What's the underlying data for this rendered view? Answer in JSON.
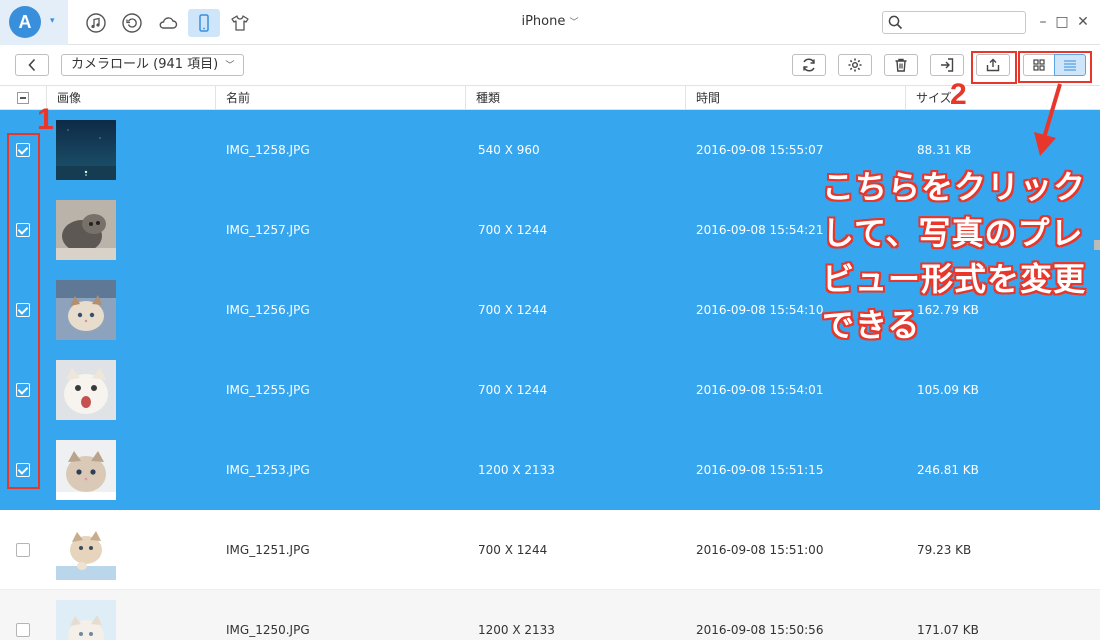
{
  "window": {
    "title": "iPhone",
    "search_placeholder": ""
  },
  "top_icons": [
    "music-icon",
    "restore-icon",
    "cloud-icon",
    "phone-icon",
    "tshirt-icon"
  ],
  "toolbar": {
    "album_label": "カメラロール (941 項目)"
  },
  "table": {
    "columns": [
      "画像",
      "名前",
      "種類",
      "時間",
      "サイズ"
    ],
    "rows": [
      {
        "name": "IMG_1258.JPG",
        "type": "540 X 960",
        "time": "2016-09-08 15:55:07",
        "size": "88.31 KB",
        "selected": true,
        "thumb": "night-sky"
      },
      {
        "name": "IMG_1257.JPG",
        "type": "700 X 1244",
        "time": "2016-09-08 15:54:21",
        "size": "",
        "selected": true,
        "thumb": "cat-gray"
      },
      {
        "name": "IMG_1256.JPG",
        "type": "700 X 1244",
        "time": "2016-09-08 15:54:10",
        "size": "162.79 KB",
        "selected": true,
        "thumb": "kitten-blanket"
      },
      {
        "name": "IMG_1255.JPG",
        "type": "700 X 1244",
        "time": "2016-09-08 15:54:01",
        "size": "105.09 KB",
        "selected": true,
        "thumb": "kitten-white"
      },
      {
        "name": "IMG_1253.JPG",
        "type": "1200 X 2133",
        "time": "2016-09-08 15:51:15",
        "size": "246.81 KB",
        "selected": true,
        "thumb": "kitten-tabby"
      },
      {
        "name": "IMG_1251.JPG",
        "type": "700 X 1244",
        "time": "2016-09-08 15:51:00",
        "size": "79.23 KB",
        "selected": false,
        "thumb": "kitten-paw"
      },
      {
        "name": "IMG_1250.JPG",
        "type": "1200 X 2133",
        "time": "2016-09-08 15:50:56",
        "size": "171.07 KB",
        "selected": false,
        "thumb": "kitten-light"
      }
    ]
  },
  "annotations": {
    "label_1": "1",
    "label_2": "2",
    "callout_lines": [
      "こちらをクリック",
      "して、写真のプレ",
      "ビュー形式を変更",
      "できる"
    ]
  },
  "colors": {
    "selected_row": "#36a6ee",
    "annotation_red": "#e8362b",
    "accent_blue": "#3a8fdc"
  }
}
